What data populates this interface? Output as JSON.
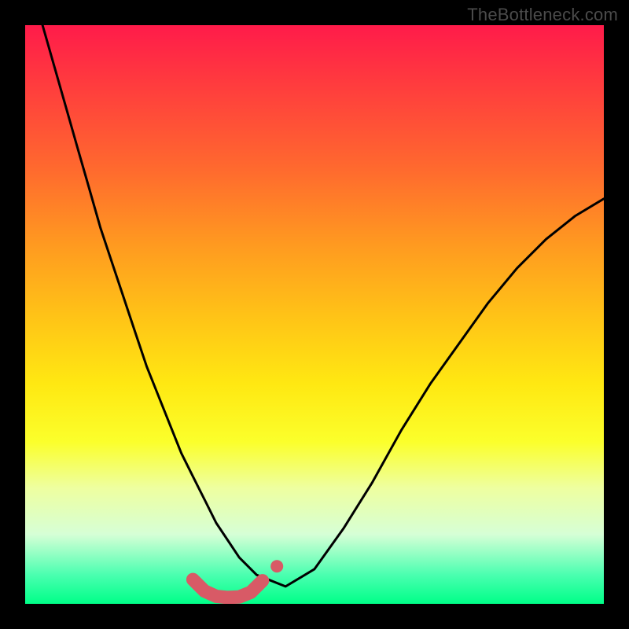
{
  "watermark": "TheBottleneck.com",
  "chart_data": {
    "type": "line",
    "title": "",
    "xlabel": "",
    "ylabel": "",
    "xlim": [
      0,
      100
    ],
    "ylim": [
      0,
      100
    ],
    "series": [
      {
        "name": "bottleneck-curve",
        "x": [
          3,
          5,
          7,
          9,
          11,
          13,
          15,
          17,
          19,
          21,
          23,
          25,
          27,
          29,
          31,
          33,
          35,
          37,
          40,
          45,
          50,
          55,
          60,
          65,
          70,
          75,
          80,
          85,
          90,
          95,
          100
        ],
        "values": [
          100,
          93,
          86,
          79,
          72,
          65,
          59,
          53,
          47,
          41,
          36,
          31,
          26,
          22,
          18,
          14,
          11,
          8,
          5,
          3,
          6,
          13,
          21,
          30,
          38,
          45,
          52,
          58,
          63,
          67,
          70
        ]
      },
      {
        "name": "highlight-segment",
        "x": [
          29,
          31,
          33,
          35,
          37,
          39,
          41
        ],
        "values": [
          4.2,
          2.2,
          1.3,
          1.1,
          1.2,
          2.0,
          4.0
        ]
      },
      {
        "name": "highlight-dot",
        "x": [
          43.5
        ],
        "values": [
          6.5
        ]
      }
    ],
    "colors": {
      "curve": "#000000",
      "highlight": "#d85a66"
    }
  }
}
